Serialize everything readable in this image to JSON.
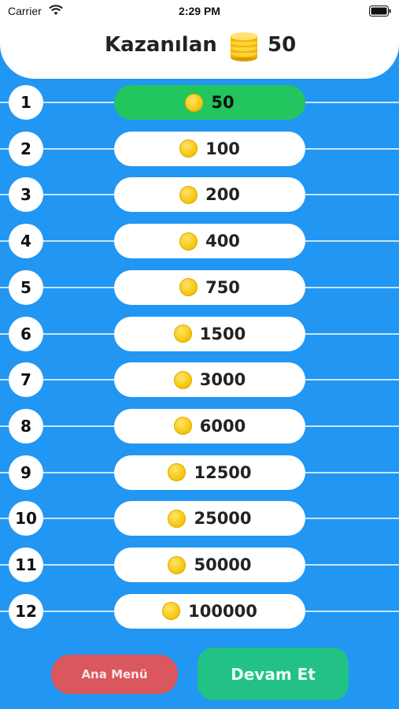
{
  "status_bar": {
    "carrier": "Carrier",
    "time": "2:29 PM",
    "icons": [
      "wifi-icon",
      "battery-icon"
    ]
  },
  "header": {
    "earned_label": "Kazanılan",
    "earned_value": "50",
    "icon": "coin-stack-icon"
  },
  "ladder": [
    {
      "level": "1",
      "prize": "50",
      "active": true
    },
    {
      "level": "2",
      "prize": "100",
      "active": false
    },
    {
      "level": "3",
      "prize": "200",
      "active": false
    },
    {
      "level": "4",
      "prize": "400",
      "active": false
    },
    {
      "level": "5",
      "prize": "750",
      "active": false
    },
    {
      "level": "6",
      "prize": "1500",
      "active": false
    },
    {
      "level": "7",
      "prize": "3000",
      "active": false
    },
    {
      "level": "8",
      "prize": "6000",
      "active": false
    },
    {
      "level": "9",
      "prize": "12500",
      "active": false
    },
    {
      "level": "10",
      "prize": "25000",
      "active": false
    },
    {
      "level": "11",
      "prize": "50000",
      "active": false
    },
    {
      "level": "12",
      "prize": "100000",
      "active": false
    }
  ],
  "buttons": {
    "main_menu": "Ana Menü",
    "continue": "Devam Et"
  },
  "colors": {
    "background": "#2196f3",
    "active_prize": "#22c55e",
    "menu_button": "#d9575d",
    "continue_button": "#22c185",
    "coin": "#f7c914"
  }
}
